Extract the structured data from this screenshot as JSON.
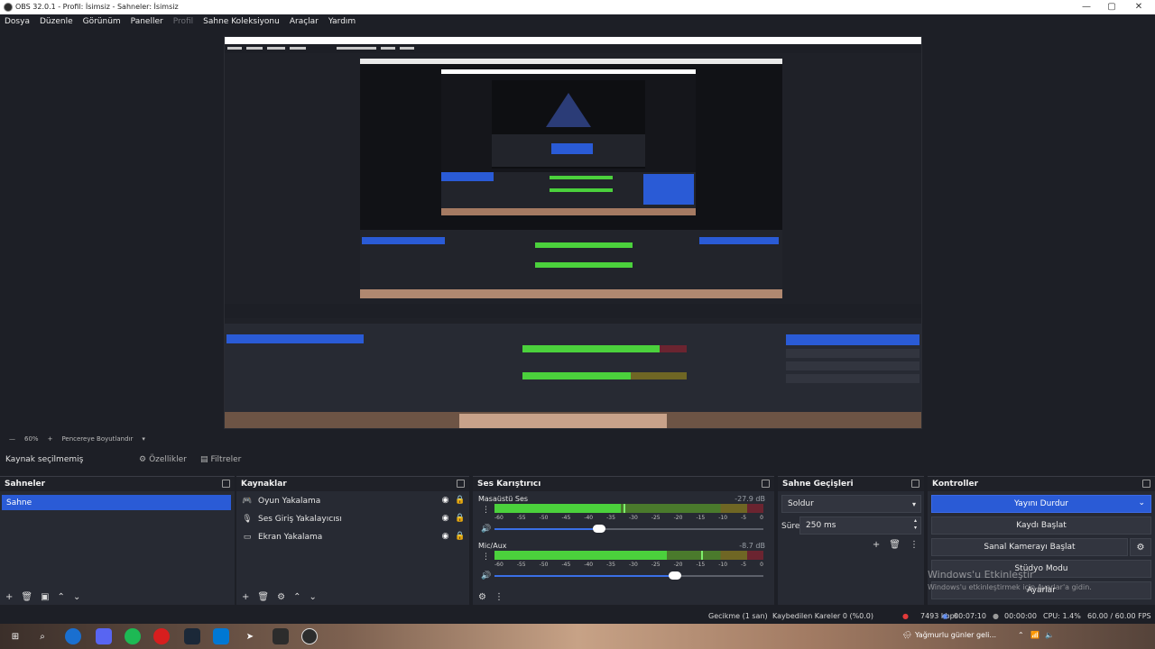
{
  "window": {
    "title": "OBS 32.0.1 - Profil: İsimsiz - Sahneler: İsimsiz",
    "controls": [
      "—",
      "▢",
      "✕"
    ]
  },
  "menu": [
    {
      "label": "Dosya",
      "disabled": false
    },
    {
      "label": "Düzenle",
      "disabled": false
    },
    {
      "label": "Görünüm",
      "disabled": false
    },
    {
      "label": "Paneller",
      "disabled": false
    },
    {
      "label": "Profil",
      "disabled": true
    },
    {
      "label": "Sahne Koleksiyonu",
      "disabled": false
    },
    {
      "label": "Araçlar",
      "disabled": false
    },
    {
      "label": "Yardım",
      "disabled": false
    }
  ],
  "preview_bar": {
    "zoom": "60%",
    "fit": "Pencereye Boyutlandır"
  },
  "source_toolbar": {
    "label": "Kaynak seçilmemiş",
    "properties": "Özellikler",
    "filters": "Filtreler"
  },
  "scenes": {
    "title": "Sahneler",
    "items": [
      "Sahne"
    ]
  },
  "sources": {
    "title": "Kaynaklar",
    "items": [
      {
        "label": "Oyun Yakalama",
        "icon": "gamepad-icon"
      },
      {
        "label": "Ses Giriş Yakalayıcısı",
        "icon": "microphone-icon"
      },
      {
        "label": "Ekran Yakalama",
        "icon": "monitor-icon"
      }
    ]
  },
  "mixer": {
    "title": "Ses Karıştırıcı",
    "scale": [
      "-60",
      "-55",
      "-50",
      "-45",
      "-40",
      "-35",
      "-30",
      "-25",
      "-20",
      "-15",
      "-10",
      "-5",
      "0"
    ],
    "channels": [
      {
        "name": "Masaüstü Ses",
        "db": "-27.9 dB",
        "level": 0.47,
        "peak": 0.48,
        "volume": 0.39
      },
      {
        "name": "Mic/Aux",
        "db": "-8.7 dB",
        "level": 0.64,
        "peak": 0.77,
        "volume": 0.67
      }
    ]
  },
  "transitions": {
    "title": "Sahne Geçişleri",
    "selected": "Soldur",
    "duration_label": "Süre",
    "duration": "250 ms"
  },
  "controls": {
    "title": "Kontroller",
    "stop_stream": "Yayını Durdur",
    "start_record": "Kaydı Başlat",
    "start_vcam": "Sanal Kamerayı Başlat",
    "studio_mode": "Stüdyo Modu",
    "settings": "Ayarlar"
  },
  "watermark": {
    "line1": "Windows'u Etkinleştir",
    "line2": "Windows'u etkinleştirmek için Ayarlar'a gidin."
  },
  "status": {
    "delay": "Gecikme (1 san)",
    "dropped": "Kaybedilen Kareler 0 (%0.0)",
    "kbps": "7493 kbps",
    "stream_time": "00:07:10",
    "rec_time": "00:00:00",
    "cpu": "CPU: 1.4%",
    "fps": "60.00 / 60.00 FPS"
  },
  "taskbar": {
    "weather": "Yağmurlu günler geli..."
  },
  "colors": {
    "accent": "#2a5bd6",
    "dock": "#272a33",
    "background": "#1d1f26",
    "meter_green": "#4bd13c",
    "meter_yellow": "#c9b52c",
    "meter_red": "#c2283c"
  }
}
